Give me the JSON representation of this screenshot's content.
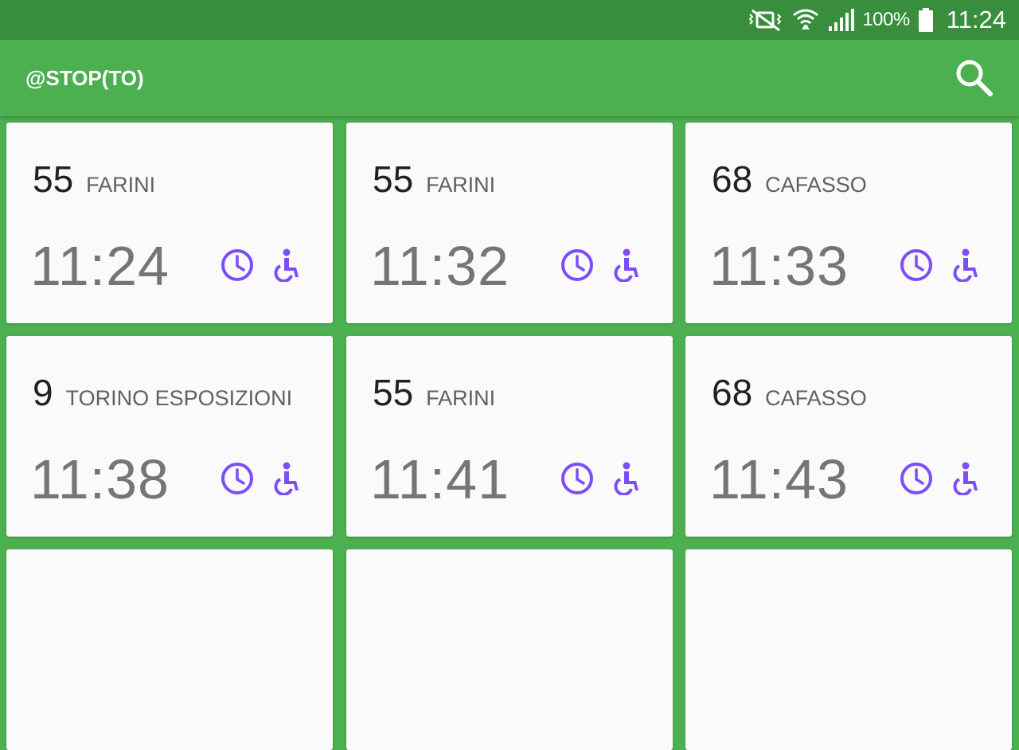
{
  "status_bar": {
    "battery_percent": "100%",
    "time": "11:24",
    "icons": [
      "vibrate-mute-icon",
      "wifi-icon",
      "signal-icon",
      "battery-icon"
    ]
  },
  "app_bar": {
    "title": "@STOP(TO)",
    "search_icon": "search-icon"
  },
  "colors": {
    "status_bar": "#388e3c",
    "app_bar": "#4caf50",
    "accent_icons": "#7c4dff",
    "card_bg": "#fafafa"
  },
  "departures": [
    {
      "line": "55",
      "destination": "FARINI",
      "time": "11:24"
    },
    {
      "line": "55",
      "destination": "FARINI",
      "time": "11:32"
    },
    {
      "line": "68",
      "destination": "CAFASSO",
      "time": "11:33"
    },
    {
      "line": "9",
      "destination": "TORINO ESPOSIZIONI",
      "time": "11:38"
    },
    {
      "line": "55",
      "destination": "FARINI",
      "time": "11:41"
    },
    {
      "line": "68",
      "destination": "CAFASSO",
      "time": "11:43"
    }
  ]
}
